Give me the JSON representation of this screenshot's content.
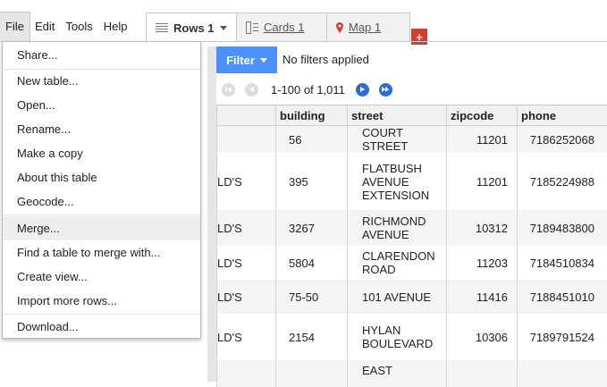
{
  "menubar": {
    "items": [
      "File",
      "Edit",
      "Tools",
      "Help"
    ]
  },
  "tabs": [
    {
      "label": "Rows 1",
      "icon": "rows-icon"
    },
    {
      "label": "Cards 1",
      "icon": "cards-icon"
    },
    {
      "label": "Map 1",
      "icon": "map-pin-icon"
    }
  ],
  "add_tab": "+",
  "filter": {
    "button_label": "Filter",
    "status": "No filters applied"
  },
  "pager": {
    "range": "1-100 of 1,011"
  },
  "colors": {
    "filter_blue": "#4d90fe",
    "add_tab_red": "#d23f31",
    "pager_blue": "#2e6bd6",
    "map_pin_red": "#d23f31"
  },
  "table": {
    "columns": [
      "",
      "building",
      "street",
      "zipcode",
      "phone"
    ],
    "rows": [
      {
        "name": "",
        "building": "56",
        "street": "COURT STREET",
        "zipcode": "11201",
        "phone": "7186252068"
      },
      {
        "name": "LD'S",
        "building": "395",
        "street": "FLATBUSH AVENUE EXTENSION",
        "zipcode": "11201",
        "phone": "7185224988"
      },
      {
        "name": "LD'S",
        "building": "3267",
        "street": "RICHMOND AVENUE",
        "zipcode": "10312",
        "phone": "7189483800"
      },
      {
        "name": "LD'S",
        "building": "5804",
        "street": "CLARENDON ROAD",
        "zipcode": "11203",
        "phone": "7184510834"
      },
      {
        "name": "LD'S",
        "building": "75-50",
        "street": "101 AVENUE",
        "zipcode": "11416",
        "phone": "7188451010"
      },
      {
        "name": "LD'S",
        "building": "2154",
        "street": "HYLAN BOULEVARD",
        "zipcode": "10306",
        "phone": "7189791524"
      },
      {
        "name": "",
        "building": "",
        "street": "EAST",
        "zipcode": "",
        "phone": ""
      }
    ]
  },
  "file_menu": {
    "items": [
      {
        "label": "Share..."
      },
      {
        "label": "New table..."
      },
      {
        "label": "Open..."
      },
      {
        "label": "Rename..."
      },
      {
        "label": "Make a copy"
      },
      {
        "label": "About this table"
      },
      {
        "label": "Geocode..."
      },
      {
        "label": "Merge...",
        "highlighted": true
      },
      {
        "label": "Find a table to merge with..."
      },
      {
        "label": "Create view..."
      },
      {
        "label": "Import more rows..."
      },
      {
        "label": "Download..."
      }
    ]
  }
}
